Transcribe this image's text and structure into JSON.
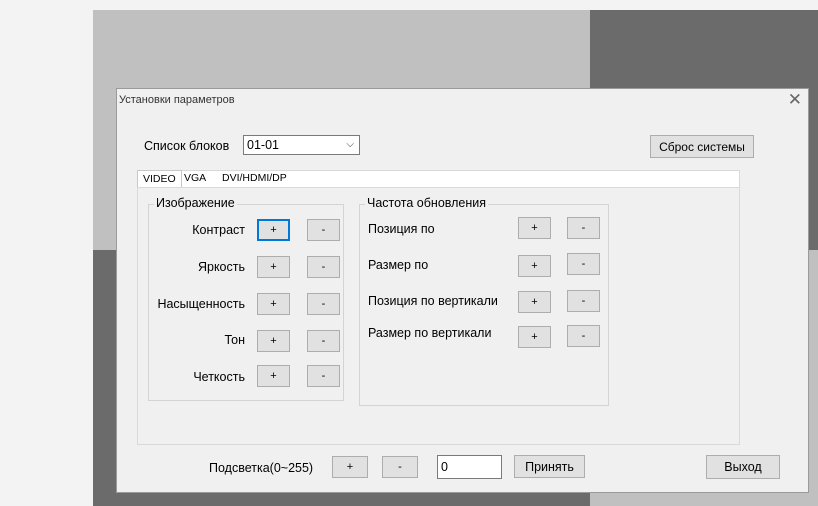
{
  "dialog": {
    "title": "Установки параметров",
    "close_glyph": "✕"
  },
  "block_list": {
    "label": "Список блоков",
    "selected": "01-01",
    "dropdown_glyph": "⌵"
  },
  "reset_button": "Сброс системы",
  "tabs": [
    {
      "label": "VIDEO",
      "active": true
    },
    {
      "label": "VGA",
      "active": false
    },
    {
      "label": "DVI/HDMI/DP",
      "active": false
    }
  ],
  "image_group": {
    "title": "Изображение",
    "rows": [
      {
        "label": "Контраст",
        "plus": "+",
        "minus": "-"
      },
      {
        "label": "Яркость",
        "plus": "+",
        "minus": "-"
      },
      {
        "label": "Насыщенность",
        "plus": "+",
        "minus": "-"
      },
      {
        "label": "Тон",
        "plus": "+",
        "minus": "-"
      },
      {
        "label": "Четкость",
        "plus": "+",
        "minus": "-"
      }
    ]
  },
  "refresh_group": {
    "title": "Частота обновления",
    "rows": [
      {
        "label": "Позиция по",
        "plus": "+",
        "minus": "-"
      },
      {
        "label": "Размер по",
        "plus": "+",
        "minus": "-"
      },
      {
        "label": "Позиция по вертикали",
        "plus": "+",
        "minus": "-"
      },
      {
        "label": "Размер по вертикали",
        "plus": "+",
        "minus": "-"
      }
    ]
  },
  "backlight": {
    "label": "Подсветка(0~255)",
    "plus": "+",
    "minus": "-",
    "value": "0",
    "apply": "Принять"
  },
  "exit_button": "Выход"
}
